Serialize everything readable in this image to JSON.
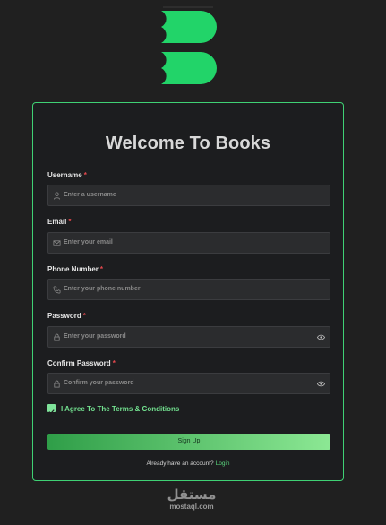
{
  "colors": {
    "accent": "#3fd174",
    "required": "#e5484d",
    "card_bg": "#1c1d1f",
    "page_bg": "#202020"
  },
  "form": {
    "title": "Welcome To Books",
    "required_mark": "*",
    "fields": [
      {
        "label": "Username",
        "placeholder": "Enter a username",
        "icon": "user-icon"
      },
      {
        "label": "Email",
        "placeholder": "Enter your email",
        "icon": "mail-icon"
      },
      {
        "label": "Phone Number",
        "placeholder": "Enter your phone number",
        "icon": "phone-icon"
      },
      {
        "label": "Password",
        "placeholder": "Enter your password",
        "icon": "lock-icon"
      },
      {
        "label": "Confirm Password",
        "placeholder": "Confirm your password",
        "icon": "lock-icon"
      }
    ],
    "agree_label": "I Agree To The Terms & Conditions",
    "agree_checked": true,
    "submit_label": "Sign Up",
    "login_prompt": "Already have an account?",
    "login_link": "Login"
  },
  "watermark": {
    "arabic": "مستقل",
    "latin": "mostaql.com"
  }
}
